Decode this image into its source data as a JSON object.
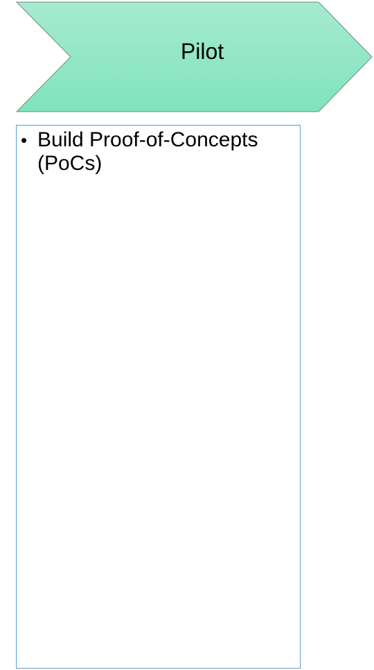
{
  "stage": {
    "title": "Pilot",
    "fill_top": "#a6ead0",
    "fill_bottom": "#80e3bd",
    "stroke": "#6a8f7e"
  },
  "details": {
    "border_color": "#5b9bd5",
    "bullets": [
      "Build Proof-of-Concepts (PoCs)"
    ]
  }
}
